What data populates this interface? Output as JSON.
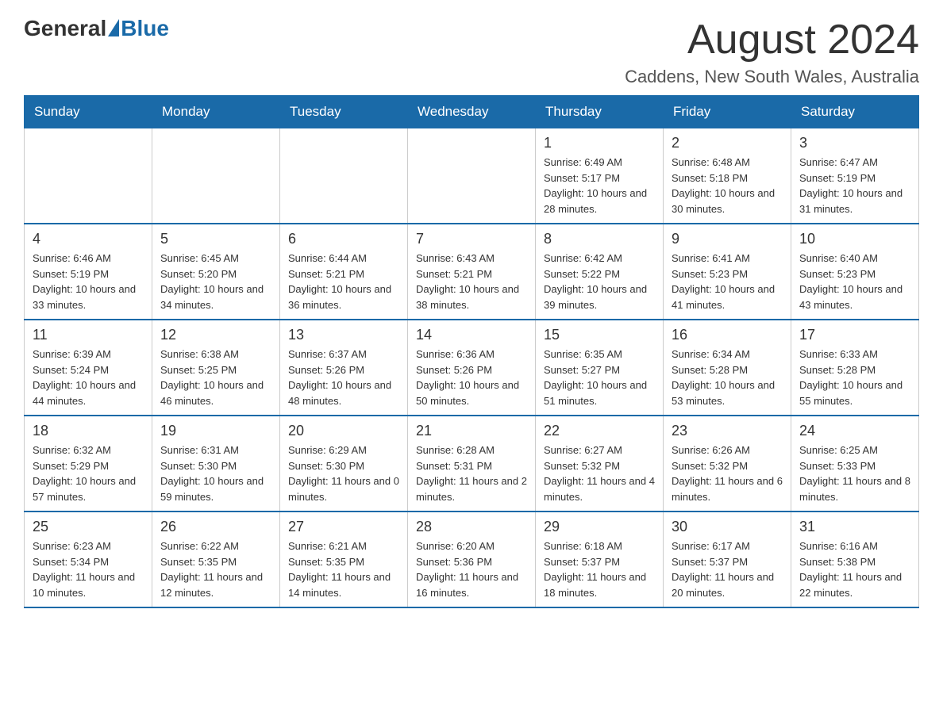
{
  "header": {
    "logo_general": "General",
    "logo_blue": "Blue",
    "month_title": "August 2024",
    "location": "Caddens, New South Wales, Australia"
  },
  "days_of_week": [
    "Sunday",
    "Monday",
    "Tuesday",
    "Wednesday",
    "Thursday",
    "Friday",
    "Saturday"
  ],
  "weeks": [
    {
      "days": [
        {
          "number": "",
          "info": ""
        },
        {
          "number": "",
          "info": ""
        },
        {
          "number": "",
          "info": ""
        },
        {
          "number": "",
          "info": ""
        },
        {
          "number": "1",
          "info": "Sunrise: 6:49 AM\nSunset: 5:17 PM\nDaylight: 10 hours and 28 minutes."
        },
        {
          "number": "2",
          "info": "Sunrise: 6:48 AM\nSunset: 5:18 PM\nDaylight: 10 hours and 30 minutes."
        },
        {
          "number": "3",
          "info": "Sunrise: 6:47 AM\nSunset: 5:19 PM\nDaylight: 10 hours and 31 minutes."
        }
      ]
    },
    {
      "days": [
        {
          "number": "4",
          "info": "Sunrise: 6:46 AM\nSunset: 5:19 PM\nDaylight: 10 hours and 33 minutes."
        },
        {
          "number": "5",
          "info": "Sunrise: 6:45 AM\nSunset: 5:20 PM\nDaylight: 10 hours and 34 minutes."
        },
        {
          "number": "6",
          "info": "Sunrise: 6:44 AM\nSunset: 5:21 PM\nDaylight: 10 hours and 36 minutes."
        },
        {
          "number": "7",
          "info": "Sunrise: 6:43 AM\nSunset: 5:21 PM\nDaylight: 10 hours and 38 minutes."
        },
        {
          "number": "8",
          "info": "Sunrise: 6:42 AM\nSunset: 5:22 PM\nDaylight: 10 hours and 39 minutes."
        },
        {
          "number": "9",
          "info": "Sunrise: 6:41 AM\nSunset: 5:23 PM\nDaylight: 10 hours and 41 minutes."
        },
        {
          "number": "10",
          "info": "Sunrise: 6:40 AM\nSunset: 5:23 PM\nDaylight: 10 hours and 43 minutes."
        }
      ]
    },
    {
      "days": [
        {
          "number": "11",
          "info": "Sunrise: 6:39 AM\nSunset: 5:24 PM\nDaylight: 10 hours and 44 minutes."
        },
        {
          "number": "12",
          "info": "Sunrise: 6:38 AM\nSunset: 5:25 PM\nDaylight: 10 hours and 46 minutes."
        },
        {
          "number": "13",
          "info": "Sunrise: 6:37 AM\nSunset: 5:26 PM\nDaylight: 10 hours and 48 minutes."
        },
        {
          "number": "14",
          "info": "Sunrise: 6:36 AM\nSunset: 5:26 PM\nDaylight: 10 hours and 50 minutes."
        },
        {
          "number": "15",
          "info": "Sunrise: 6:35 AM\nSunset: 5:27 PM\nDaylight: 10 hours and 51 minutes."
        },
        {
          "number": "16",
          "info": "Sunrise: 6:34 AM\nSunset: 5:28 PM\nDaylight: 10 hours and 53 minutes."
        },
        {
          "number": "17",
          "info": "Sunrise: 6:33 AM\nSunset: 5:28 PM\nDaylight: 10 hours and 55 minutes."
        }
      ]
    },
    {
      "days": [
        {
          "number": "18",
          "info": "Sunrise: 6:32 AM\nSunset: 5:29 PM\nDaylight: 10 hours and 57 minutes."
        },
        {
          "number": "19",
          "info": "Sunrise: 6:31 AM\nSunset: 5:30 PM\nDaylight: 10 hours and 59 minutes."
        },
        {
          "number": "20",
          "info": "Sunrise: 6:29 AM\nSunset: 5:30 PM\nDaylight: 11 hours and 0 minutes."
        },
        {
          "number": "21",
          "info": "Sunrise: 6:28 AM\nSunset: 5:31 PM\nDaylight: 11 hours and 2 minutes."
        },
        {
          "number": "22",
          "info": "Sunrise: 6:27 AM\nSunset: 5:32 PM\nDaylight: 11 hours and 4 minutes."
        },
        {
          "number": "23",
          "info": "Sunrise: 6:26 AM\nSunset: 5:32 PM\nDaylight: 11 hours and 6 minutes."
        },
        {
          "number": "24",
          "info": "Sunrise: 6:25 AM\nSunset: 5:33 PM\nDaylight: 11 hours and 8 minutes."
        }
      ]
    },
    {
      "days": [
        {
          "number": "25",
          "info": "Sunrise: 6:23 AM\nSunset: 5:34 PM\nDaylight: 11 hours and 10 minutes."
        },
        {
          "number": "26",
          "info": "Sunrise: 6:22 AM\nSunset: 5:35 PM\nDaylight: 11 hours and 12 minutes."
        },
        {
          "number": "27",
          "info": "Sunrise: 6:21 AM\nSunset: 5:35 PM\nDaylight: 11 hours and 14 minutes."
        },
        {
          "number": "28",
          "info": "Sunrise: 6:20 AM\nSunset: 5:36 PM\nDaylight: 11 hours and 16 minutes."
        },
        {
          "number": "29",
          "info": "Sunrise: 6:18 AM\nSunset: 5:37 PM\nDaylight: 11 hours and 18 minutes."
        },
        {
          "number": "30",
          "info": "Sunrise: 6:17 AM\nSunset: 5:37 PM\nDaylight: 11 hours and 20 minutes."
        },
        {
          "number": "31",
          "info": "Sunrise: 6:16 AM\nSunset: 5:38 PM\nDaylight: 11 hours and 22 minutes."
        }
      ]
    }
  ]
}
